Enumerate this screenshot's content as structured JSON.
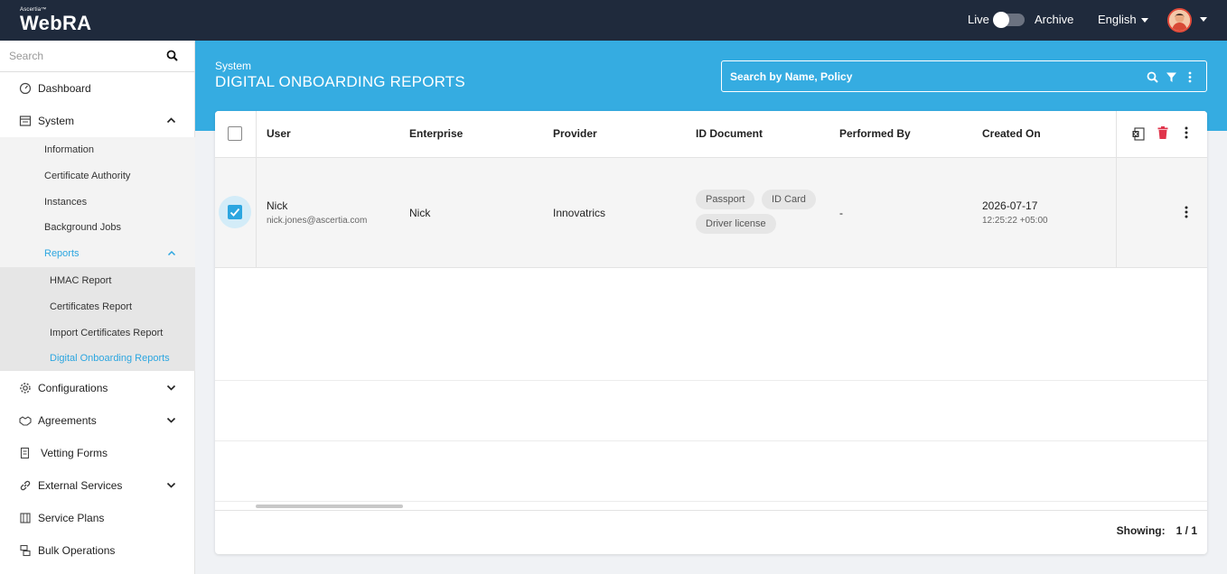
{
  "brand": {
    "company": "Ascertia™",
    "product": "WebRA"
  },
  "topbar": {
    "live_label": "Live",
    "archive_label": "Archive",
    "language": "English"
  },
  "sidebar": {
    "search_placeholder": "Search",
    "items": {
      "dashboard": "Dashboard",
      "system": "System",
      "configurations": "Configurations",
      "agreements": "Agreements",
      "vetting_forms": "Vetting Forms",
      "external_services": "External Services",
      "service_plans": "Service Plans",
      "bulk_operations": "Bulk Operations"
    },
    "system_sub": {
      "information": "Information",
      "certificate_authority": "Certificate Authority",
      "instances": "Instances",
      "background_jobs": "Background Jobs",
      "reports": "Reports"
    },
    "reports_sub": {
      "hmac": "HMAC Report",
      "certificates": "Certificates Report",
      "import_certificates": "Import Certificates Report",
      "digital_onboarding": "Digital Onboarding Reports"
    }
  },
  "header": {
    "breadcrumb": "System",
    "title": "DIGITAL ONBOARDING REPORTS",
    "search_placeholder": "Search by Name, Policy"
  },
  "table": {
    "columns": {
      "user": "User",
      "enterprise": "Enterprise",
      "provider": "Provider",
      "id_document": "ID Document",
      "performed_by": "Performed By",
      "created_on": "Created On"
    },
    "rows": [
      {
        "user_name": "Nick",
        "user_email": "nick.jones@ascertia.com",
        "enterprise": "Nick",
        "provider": "Innovatrics",
        "documents": [
          "Passport",
          "ID Card",
          "Driver license"
        ],
        "performed_by": "-",
        "created_date": "2026-07-17",
        "created_time": "12:25:22 +05:00",
        "selected": true
      }
    ]
  },
  "footer": {
    "showing_label": "Showing:",
    "showing_value": "1 / 1"
  },
  "colors": {
    "topbar": "#1f2a3c",
    "accent": "#35ace1",
    "active": "#2ca6e0",
    "delete": "#e0344b"
  }
}
